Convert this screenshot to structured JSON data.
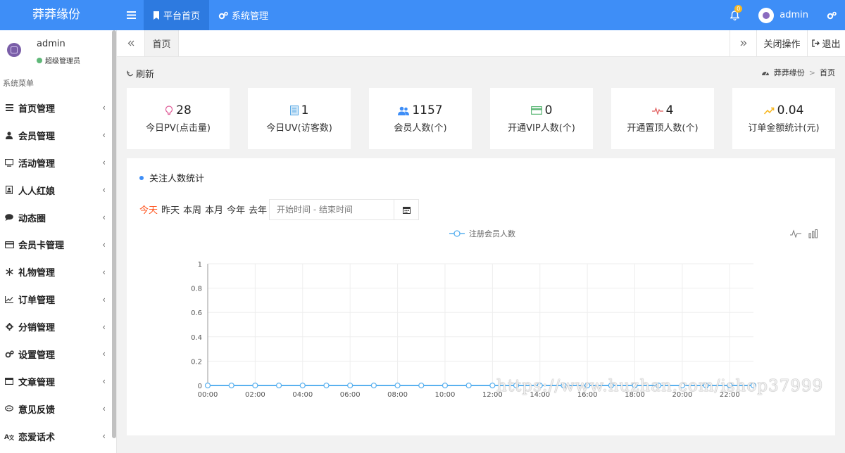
{
  "app": {
    "brand": "莽莽缘份",
    "top_nav": [
      {
        "label": "平台首页",
        "icon": "bookmark-icon"
      },
      {
        "label": "系统管理",
        "icon": "gears-icon"
      }
    ],
    "notification_count": "0",
    "user": "admin"
  },
  "sidebar": {
    "user_name": "admin",
    "user_role": "超级管理员",
    "menu_title": "系统菜单",
    "items": [
      {
        "label": "首页管理",
        "icon": "list-icon"
      },
      {
        "label": "会员管理",
        "icon": "user-icon"
      },
      {
        "label": "活动管理",
        "icon": "monitor-icon"
      },
      {
        "label": "人人红娘",
        "icon": "contact-card-icon"
      },
      {
        "label": "动态圈",
        "icon": "comment-icon"
      },
      {
        "label": "会员卡管理",
        "icon": "credit-card-icon"
      },
      {
        "label": "礼物管理",
        "icon": "snowflake-icon"
      },
      {
        "label": "订单管理",
        "icon": "line-chart-icon"
      },
      {
        "label": "分销管理",
        "icon": "gear-icon"
      },
      {
        "label": "设置管理",
        "icon": "gears-icon"
      },
      {
        "label": "文章管理",
        "icon": "window-icon"
      },
      {
        "label": "意见反馈",
        "icon": "comments-icon"
      },
      {
        "label": "恋爱话术",
        "icon": "language-icon"
      }
    ]
  },
  "tabs": {
    "home": "首页",
    "close_ops": "关闭操作",
    "logout": "退出"
  },
  "content": {
    "refresh": "刷新",
    "breadcrumb": [
      "莽莽缘份",
      "首页"
    ]
  },
  "stats": [
    {
      "value": "28",
      "label": "今日PV(点击量)",
      "icon": "lightbulb-icon",
      "color": "#e0609a"
    },
    {
      "value": "1",
      "label": "今日UV(访客数)",
      "icon": "document-icon",
      "color": "#5aa9e6"
    },
    {
      "value": "1157",
      "label": "会员人数(个)",
      "icon": "users-icon",
      "color": "#3e8ef7"
    },
    {
      "value": "0",
      "label": "开通VIP人数(个)",
      "icon": "credit-card-icon",
      "color": "#5fb878"
    },
    {
      "value": "4",
      "label": "开通置顶人数(个)",
      "icon": "heartbeat-icon",
      "color": "#e05a5a"
    },
    {
      "value": "0.04",
      "label": "订单金额统计(元)",
      "icon": "trend-up-icon",
      "color": "#f7b824"
    }
  ],
  "panel": {
    "title": "关注人数统计",
    "quick_ranges": [
      "今天",
      "昨天",
      "本周",
      "本月",
      "今年",
      "去年"
    ],
    "active_range": 0,
    "date_placeholder": "开始时间 - 结束时间"
  },
  "chart_data": {
    "type": "line",
    "series": [
      {
        "name": "注册会员人数",
        "values": [
          0,
          0,
          0,
          0,
          0,
          0,
          0,
          0,
          0,
          0,
          0,
          0,
          0,
          0,
          0,
          0,
          0,
          0,
          0,
          0,
          0,
          0,
          0,
          0
        ]
      }
    ],
    "x": [
      "00:00",
      "01:00",
      "02:00",
      "03:00",
      "04:00",
      "05:00",
      "06:00",
      "07:00",
      "08:00",
      "09:00",
      "10:00",
      "11:00",
      "12:00",
      "13:00",
      "14:00",
      "15:00",
      "16:00",
      "17:00",
      "18:00",
      "19:00",
      "20:00",
      "21:00",
      "22:00",
      "23:00"
    ],
    "x_tick_labels": [
      "00:00",
      "02:00",
      "04:00",
      "06:00",
      "08:00",
      "10:00",
      "12:00",
      "14:00",
      "16:00",
      "18:00",
      "20:00",
      "22:00"
    ],
    "y_ticks": [
      "0",
      "0.2",
      "0.4",
      "0.6",
      "0.8",
      "1"
    ],
    "ylim": [
      0,
      1
    ],
    "grid": true,
    "legend": "top-center",
    "color": "#5ab1ef"
  },
  "watermark": "https://www.huzhan.com/ishop37999"
}
